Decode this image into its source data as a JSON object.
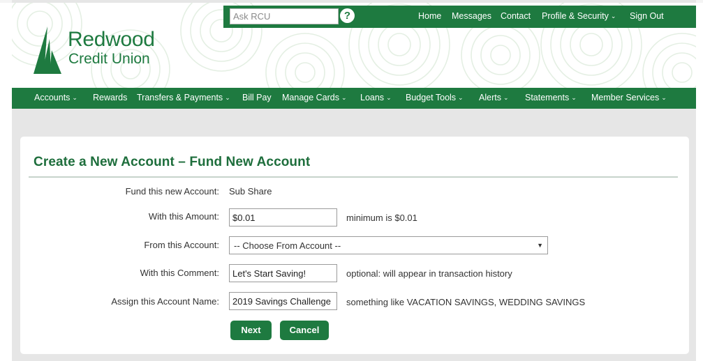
{
  "utility": {
    "search_placeholder": "Ask RCU",
    "help_glyph": "?",
    "links": [
      {
        "label": "Home",
        "has_menu": false
      },
      {
        "label": "Messages",
        "has_menu": false
      },
      {
        "label": "Contact",
        "has_menu": false
      },
      {
        "label": "Profile & Security",
        "has_menu": true
      },
      {
        "label": "Sign Out",
        "has_menu": false
      }
    ]
  },
  "brand": {
    "line1": "Redwood",
    "line2": "Credit Union",
    "color": "#1e7a40"
  },
  "nav": {
    "items": [
      {
        "label": "Accounts",
        "has_menu": true
      },
      {
        "label": "Rewards",
        "has_menu": false
      },
      {
        "label": "Transfers & Payments",
        "has_menu": true
      },
      {
        "label": "Bill Pay",
        "has_menu": false
      },
      {
        "label": "Manage Cards",
        "has_menu": true
      },
      {
        "label": "Loans",
        "has_menu": true
      },
      {
        "label": "Budget Tools",
        "has_menu": true
      },
      {
        "label": "Alerts",
        "has_menu": true
      },
      {
        "label": "Statements",
        "has_menu": true
      },
      {
        "label": "Member Services",
        "has_menu": true
      }
    ]
  },
  "form": {
    "title": "Create a New Account – Fund New Account",
    "fund_label": "Fund this new Account:",
    "fund_value": "Sub Share",
    "amount_label": "With this Amount:",
    "amount_value": "$0.01",
    "amount_hint": "minimum is $0.01",
    "from_label": "From this Account:",
    "from_selected": "-- Choose From Account --",
    "comment_label": "With this Comment:",
    "comment_value": "Let's Start Saving!",
    "comment_hint": "optional: will appear in transaction history",
    "name_label": "Assign this Account Name:",
    "name_value": "2019 Savings Challenge",
    "name_hint": "something like VACATION SAVINGS, WEDDING SAVINGS",
    "next_label": "Next",
    "cancel_label": "Cancel"
  },
  "icons": {
    "help": "help-circle-icon",
    "chevron": "chevron-down-icon",
    "logo": "redwood-tree-logo"
  },
  "colors": {
    "brand_green": "#1e7a40",
    "title_green": "#1e6e3c",
    "page_bg": "#e6e6e6"
  }
}
